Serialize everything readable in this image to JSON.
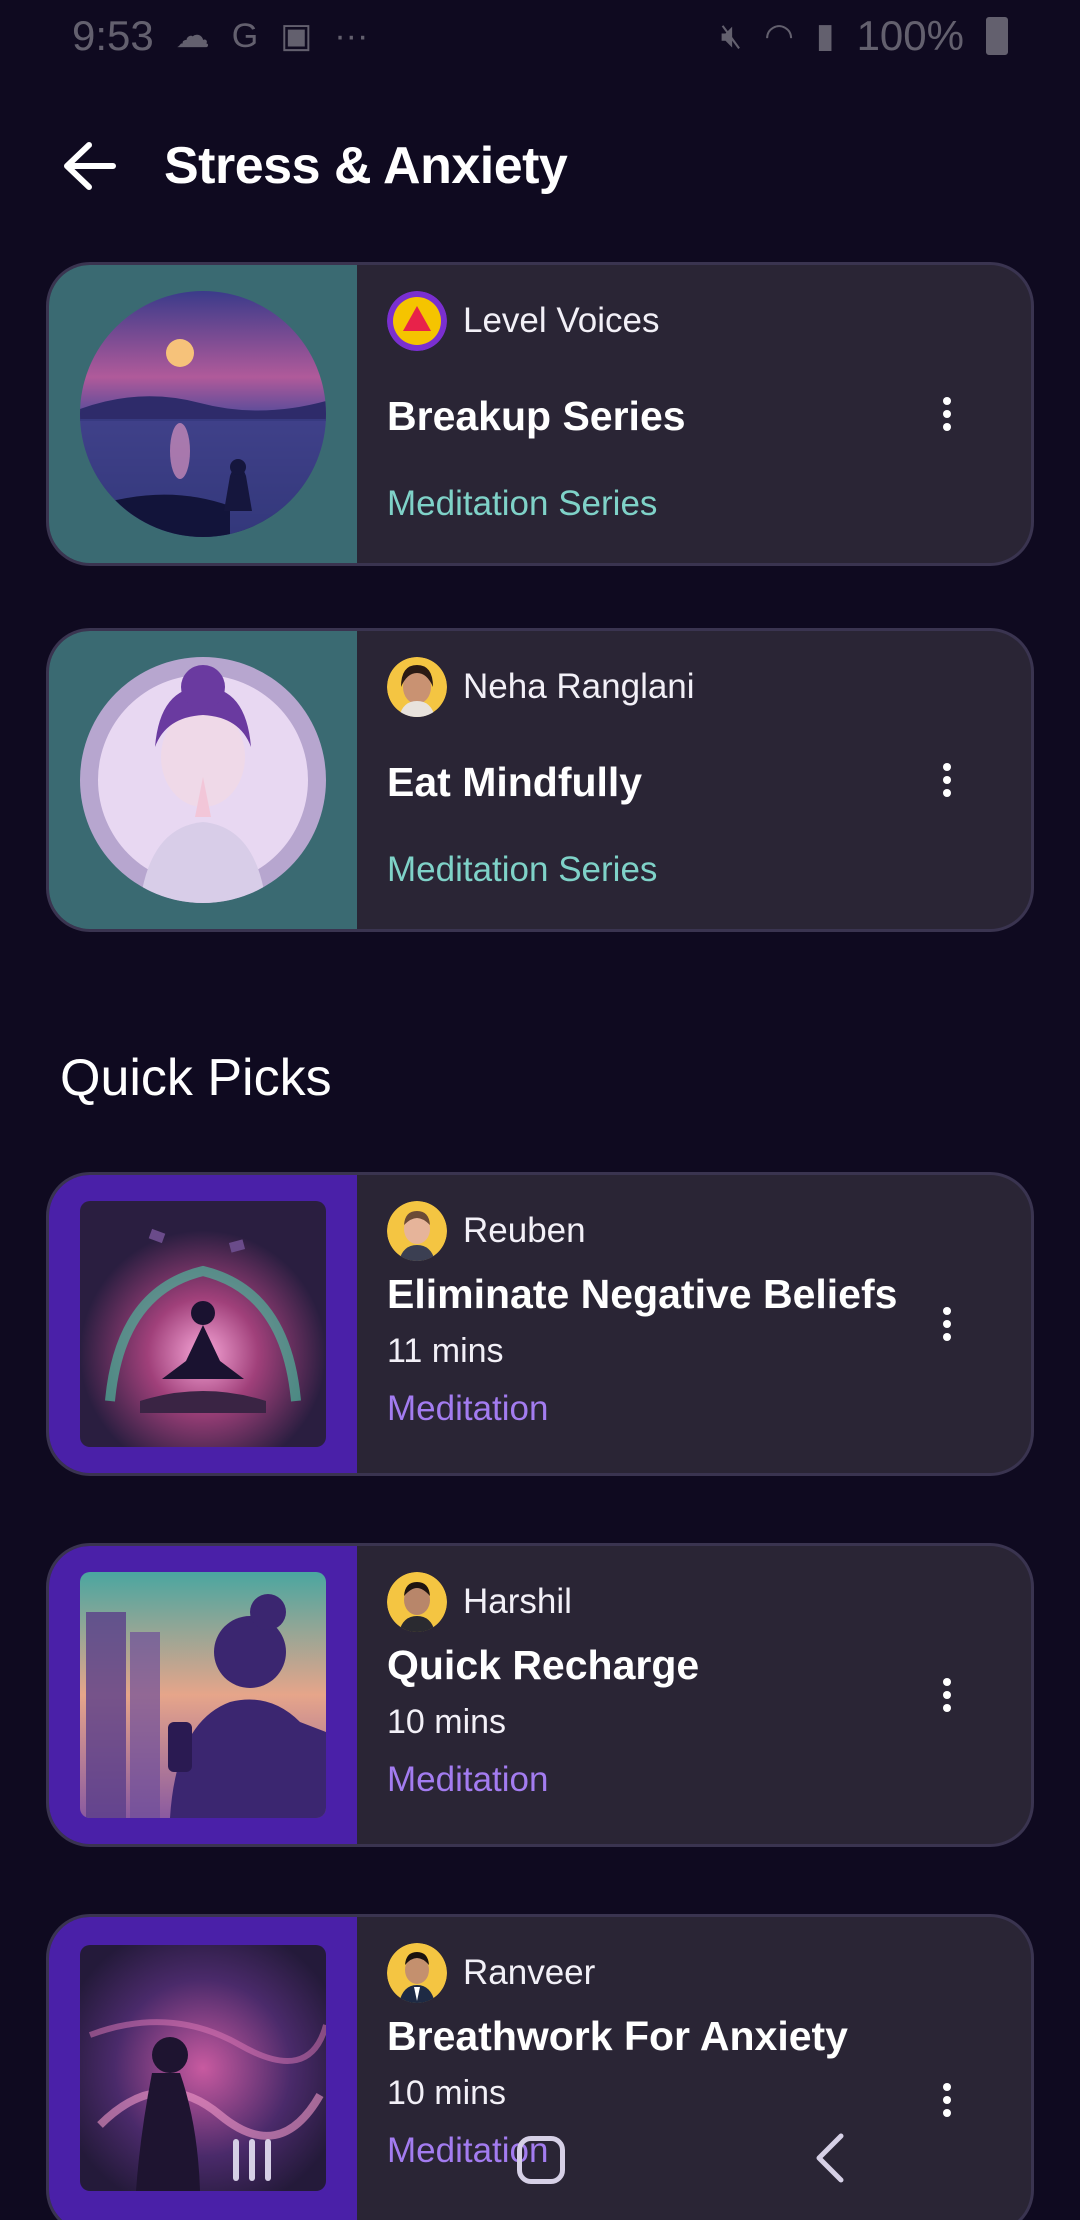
{
  "status_bar": {
    "time": "9:53",
    "left_icons": [
      "cloud-icon",
      "google-icon",
      "teams-icon",
      "more-dots-icon"
    ],
    "battery": "100%"
  },
  "header": {
    "title": "Stress & Anxiety"
  },
  "series_cards": [
    {
      "author": "Level Voices",
      "title": "Breakup Series",
      "type": "Meditation Series"
    },
    {
      "author": "Neha Ranglani",
      "title": "Eat Mindfully",
      "type": "Meditation Series"
    }
  ],
  "quick_picks": {
    "section_title": "Quick Picks",
    "items": [
      {
        "author": "Reuben",
        "title": "Eliminate Negative Beliefs",
        "duration": "11 mins",
        "type": "Meditation"
      },
      {
        "author": "Harshil",
        "title": "Quick Recharge",
        "duration": "10 mins",
        "type": "Meditation"
      },
      {
        "author": "Ranveer",
        "title": "Breathwork For Anxiety",
        "duration": "10 mins",
        "type": "Meditation"
      }
    ]
  },
  "colors": {
    "background": "#0f0a20",
    "card": "#2a2535",
    "teal_accent": "#7fd2c8",
    "purple_accent": "#a37cf0",
    "media_purple": "#4a20a8",
    "media_teal": "#3a6a72"
  }
}
